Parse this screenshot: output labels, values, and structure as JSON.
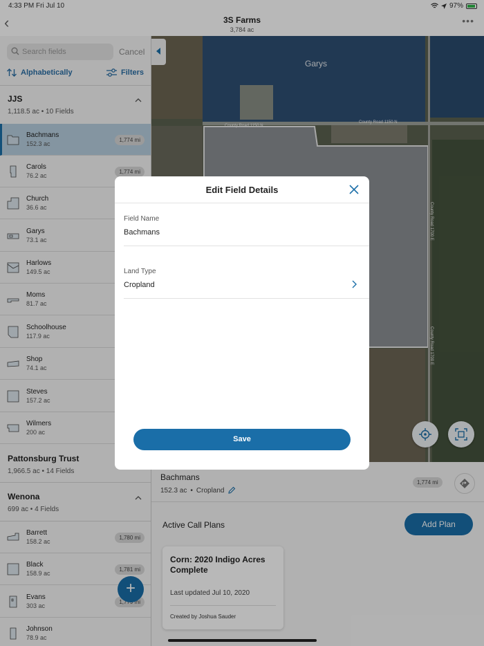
{
  "status_bar": {
    "time": "4:33 PM",
    "date": "Fri Jul 10",
    "battery": "97%"
  },
  "nav": {
    "title": "3S Farms",
    "subtitle": "3,784 ac"
  },
  "sidebar": {
    "search_placeholder": "Search fields",
    "cancel_label": "Cancel",
    "sort_label": "Alphabetically",
    "filters_label": "Filters",
    "groups": [
      {
        "name": "JJS",
        "area": "1,118.5 ac",
        "count": "10 Fields",
        "fields": [
          {
            "name": "Bachmans",
            "area": "152.3 ac",
            "distance": "1,774 mi"
          },
          {
            "name": "Carols",
            "area": "76.2 ac",
            "distance": "1,774 mi"
          },
          {
            "name": "Church",
            "area": "36.6 ac"
          },
          {
            "name": "Garys",
            "area": "73.1 ac"
          },
          {
            "name": "Harlows",
            "area": "149.5 ac"
          },
          {
            "name": "Moms",
            "area": "81.7 ac"
          },
          {
            "name": "Schoolhouse",
            "area": "117.9 ac"
          },
          {
            "name": "Shop",
            "area": "74.1 ac"
          },
          {
            "name": "Steves",
            "area": "157.2 ac"
          },
          {
            "name": "Wilmers",
            "area": "200 ac"
          }
        ]
      },
      {
        "name": "Pattonsburg Trust",
        "area": "1,966.5 ac",
        "count": "14 Fields"
      },
      {
        "name": "Wenona",
        "area": "699 ac",
        "count": "4 Fields",
        "fields": [
          {
            "name": "Barrett",
            "area": "158.2 ac",
            "distance": "1,780 mi"
          },
          {
            "name": "Black",
            "area": "158.9 ac",
            "distance": "1,781 mi"
          },
          {
            "name": "Evans",
            "area": "303 ac",
            "distance": "1,779 mi"
          },
          {
            "name": "Johnson",
            "area": "78.9 ac"
          }
        ]
      }
    ],
    "add_label": "+"
  },
  "map": {
    "field_label": "Garys",
    "road1": "County Road 1150 N",
    "road2": "County Road 1150 N",
    "road3": "County Road 1700 E",
    "road4": "County Road 1700 E"
  },
  "bottom_panel": {
    "field_name": "Bachmans",
    "area": "152.3 ac",
    "land_type": "Cropland",
    "distance": "1,774 mi",
    "active_plans_label": "Active Call Plans",
    "add_plan_label": "Add Plan",
    "plan": {
      "title": "Corn: 2020 Indigo Acres Complete",
      "updated": "Last updated Jul 10, 2020",
      "created": "Created by Joshua Sauder"
    }
  },
  "modal": {
    "title": "Edit Field Details",
    "field_name_label": "Field Name",
    "field_name_value": "Bachmans",
    "land_type_label": "Land Type",
    "land_type_value": "Cropland",
    "save_label": "Save"
  },
  "colors": {
    "accent": "#1a6ea8",
    "selected_row": "#b7cfdf"
  }
}
